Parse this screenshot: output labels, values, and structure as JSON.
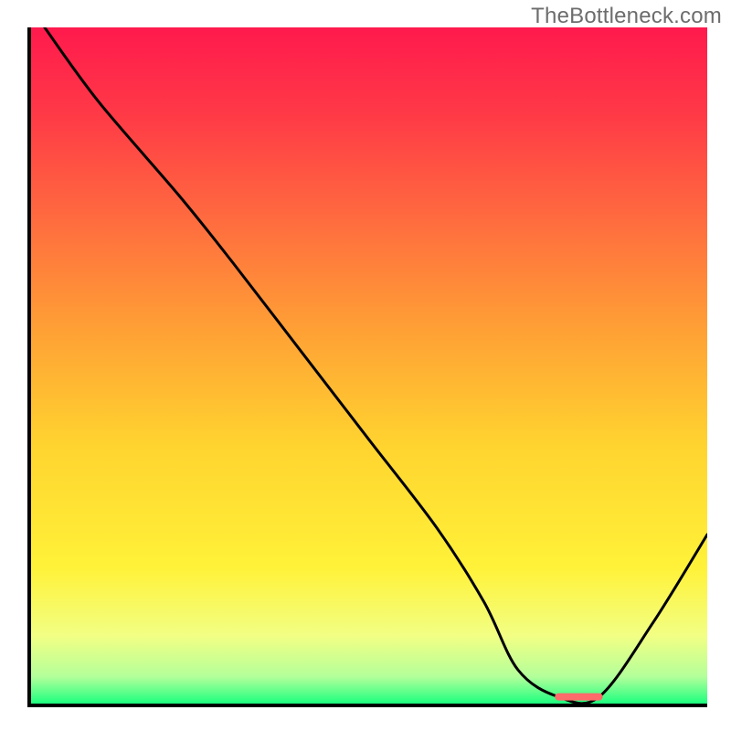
{
  "watermark": "TheBottleneck.com",
  "chart_data": {
    "type": "line",
    "title": "",
    "xlabel": "",
    "ylabel": "",
    "xlim": [
      0,
      100
    ],
    "ylim": [
      0,
      100
    ],
    "grid": false,
    "gradient_stops": [
      {
        "offset": 0.0,
        "color": "#ff1a4d"
      },
      {
        "offset": 0.12,
        "color": "#ff3747"
      },
      {
        "offset": 0.28,
        "color": "#ff6a3f"
      },
      {
        "offset": 0.45,
        "color": "#ffa135"
      },
      {
        "offset": 0.62,
        "color": "#ffd42f"
      },
      {
        "offset": 0.8,
        "color": "#fff239"
      },
      {
        "offset": 0.9,
        "color": "#f2ff84"
      },
      {
        "offset": 0.96,
        "color": "#b4ff9a"
      },
      {
        "offset": 1.0,
        "color": "#1dff7f"
      }
    ],
    "series": [
      {
        "name": "curve",
        "x": [
          2,
          10,
          22,
          30,
          40,
          50,
          60,
          67,
          72,
          78,
          84,
          92,
          100
        ],
        "y": [
          100,
          89,
          75,
          65,
          52,
          39,
          26,
          15,
          5,
          1,
          1,
          12,
          25
        ]
      }
    ],
    "marker": {
      "color": "#ff6a6a",
      "x_start": 78,
      "x_end": 84,
      "y": 1,
      "thickness": 8
    }
  }
}
